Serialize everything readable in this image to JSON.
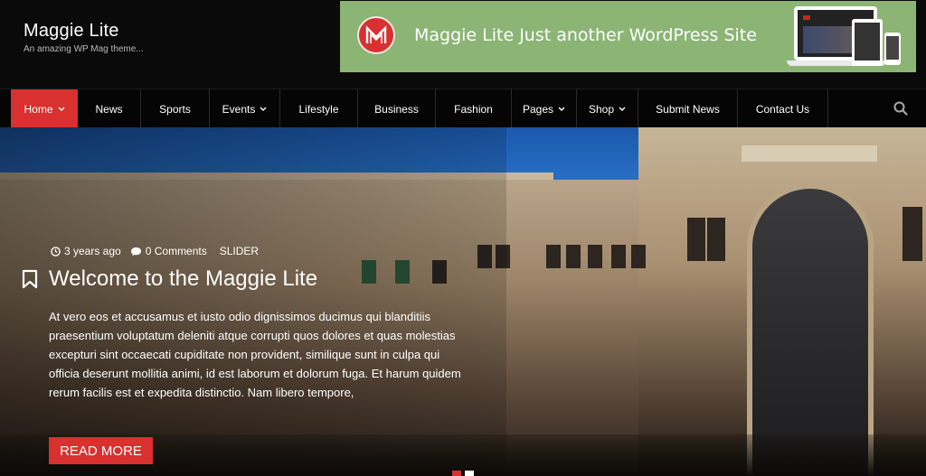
{
  "header": {
    "site_title": "Maggie Lite",
    "tagline": "An amazing WP Mag theme..."
  },
  "banner": {
    "text": "Maggie Lite Just another WordPress Site"
  },
  "nav": {
    "items": [
      {
        "label": "Home",
        "active": true,
        "has_dropdown": true
      },
      {
        "label": "News"
      },
      {
        "label": "Sports"
      },
      {
        "label": "Events",
        "has_dropdown": true
      },
      {
        "label": "Lifestyle"
      },
      {
        "label": "Business"
      },
      {
        "label": "Fashion"
      },
      {
        "label": "Pages",
        "has_dropdown": true
      },
      {
        "label": "Shop",
        "has_dropdown": true
      },
      {
        "label": "Submit News"
      },
      {
        "label": "Contact Us"
      }
    ],
    "search_icon": "search-icon"
  },
  "hero": {
    "time": "3 years ago",
    "comments": "0 Comments",
    "category": "SLIDER",
    "title": "Welcome to the Maggie Lite",
    "excerpt": "At vero eos et accusamus et iusto odio dignissimos ducimus qui blanditiis praesentium voluptatum deleniti atque corrupti quos dolores et quas molestias excepturi sint occaecati cupiditate non provident, similique sunt in culpa qui officia deserunt mollitia animi, id est laborum et dolorum fuga. Et harum quidem rerum facilis est et expedita distinctio. Nam libero tempore,",
    "read_more": "READ MORE"
  },
  "colors": {
    "accent": "#d8312f",
    "banner_bg": "#8bb475",
    "header_bg": "#0a0a0a"
  }
}
